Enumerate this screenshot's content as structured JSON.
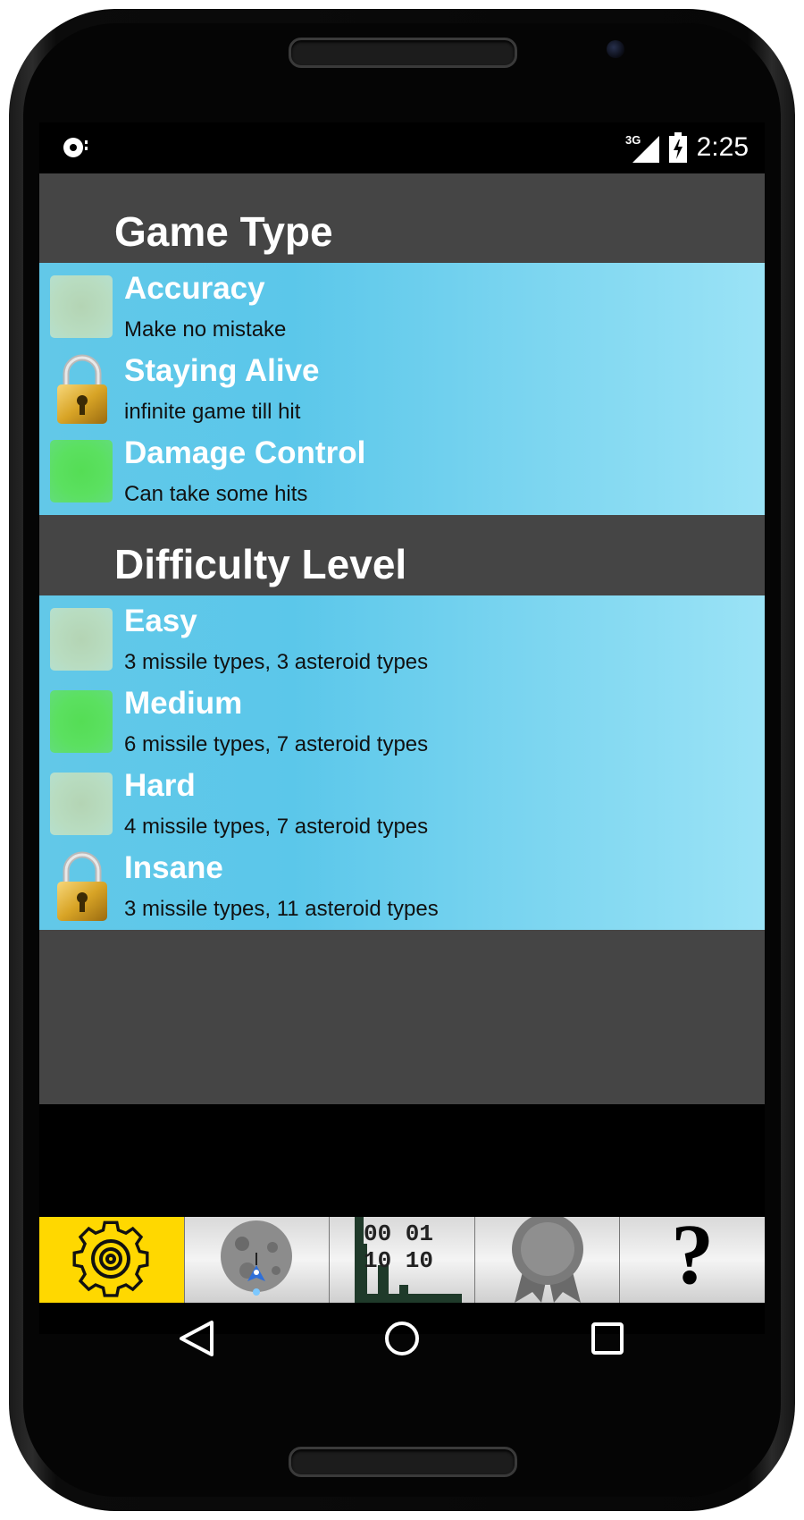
{
  "status_bar": {
    "network": "3G",
    "time": "2:25"
  },
  "game_type": {
    "title": "Game Type",
    "items": [
      {
        "title": "Accuracy",
        "subtitle": "Make no mistake",
        "state": "unchecked"
      },
      {
        "title": "Staying Alive",
        "subtitle": "infinite game till hit",
        "state": "locked"
      },
      {
        "title": "Damage Control",
        "subtitle": "Can take some hits",
        "state": "checked"
      }
    ]
  },
  "difficulty": {
    "title": "Difficulty Level",
    "items": [
      {
        "title": "Easy",
        "subtitle": "3 missile types, 3 asteroid types",
        "state": "unchecked"
      },
      {
        "title": "Medium",
        "subtitle": "6 missile types, 7 asteroid types",
        "state": "checked"
      },
      {
        "title": "Hard",
        "subtitle": "4 missile types, 7 asteroid types",
        "state": "unchecked"
      },
      {
        "title": "Insane",
        "subtitle": "3 missile types, 11 asteroid types",
        "state": "locked"
      }
    ]
  },
  "tabs": {
    "items": [
      {
        "icon": "gear-icon",
        "active": true
      },
      {
        "icon": "asteroid-ship-icon",
        "active": false
      },
      {
        "icon": "binary-stats-icon",
        "active": false,
        "text_line1": "00 01",
        "text_line2": "10 10"
      },
      {
        "icon": "award-ribbon-icon",
        "active": false
      },
      {
        "icon": "help-icon",
        "active": false,
        "text": "?"
      }
    ]
  },
  "colors": {
    "row_gradient_start": "#5bc7ea",
    "row_gradient_end": "#9be3f6",
    "panel_background": "#454545",
    "active_tab": "#ffd800",
    "checked_box": "#55dd55",
    "unchecked_box": "#b8dcc0"
  }
}
